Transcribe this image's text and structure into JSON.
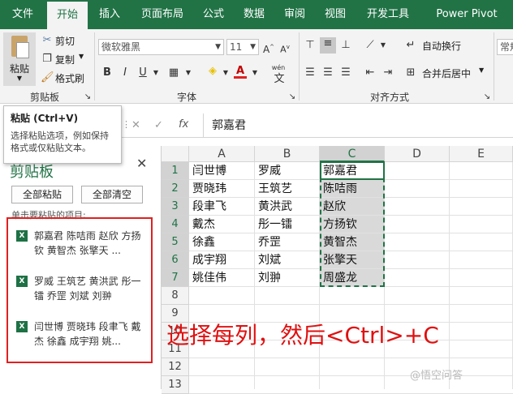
{
  "tabs": [
    "文件",
    "开始",
    "插入",
    "页面布局",
    "公式",
    "数据",
    "审阅",
    "视图",
    "开发工具",
    "Power Pivot"
  ],
  "active_tab": "开始",
  "ribbon": {
    "paste": "粘贴",
    "cut": "剪切",
    "copy": "复制",
    "format_painter": "格式刷",
    "group_clipboard": "剪贴板",
    "font_name": "微软雅黑",
    "font_size": "11",
    "bold": "B",
    "italic": "I",
    "underline": "U",
    "phonetic": "wén",
    "font_color_letter": "A",
    "group_font": "字体",
    "wrap_text": "自动换行",
    "merge_center": "合并后居中",
    "group_alignment": "对齐方式",
    "number_format": "常规"
  },
  "tooltip": {
    "title": "粘贴 (Ctrl+V)",
    "body": "选择粘贴选项，例如保持格式或仅粘贴文本。"
  },
  "formula_bar": {
    "cancel": "✕",
    "enter": "✓",
    "fx": "fx",
    "content": "郭嘉君"
  },
  "clipboard_pane": {
    "title": "剪贴板",
    "close": "✕",
    "paste_all": "全部粘贴",
    "clear_all": "全部清空",
    "hint": "单击要粘贴的项目:",
    "items": [
      "郭嘉君 陈咭雨 赵欣 方扬钦 黄智杰 张擎天 ...",
      "罗威 王筑艺 黄洪武 彤一镭 乔罡 刘斌 刘翀",
      "闫世博 贾晓玮 段聿飞 戴杰 徐鑫 成宇翔 姚..."
    ]
  },
  "grid": {
    "columns": [
      "A",
      "B",
      "C",
      "D",
      "E"
    ],
    "rows": [
      "1",
      "2",
      "3",
      "4",
      "5",
      "6",
      "7",
      "8",
      "9",
      "10",
      "11",
      "12",
      "13"
    ],
    "cells": [
      [
        "闫世博",
        "罗威",
        "郭嘉君"
      ],
      [
        "贾晓玮",
        "王筑艺",
        "陈咭雨"
      ],
      [
        "段聿飞",
        "黄洪武",
        "赵欣"
      ],
      [
        "戴杰",
        "彤一镭",
        "方扬钦"
      ],
      [
        "徐鑫",
        "乔罡",
        "黄智杰"
      ],
      [
        "成宇翔",
        "刘斌",
        "张擎天"
      ],
      [
        "姚佳伟",
        "刘翀",
        "周盛龙"
      ]
    ]
  },
  "annotation": "选择每列，然后<Ctrl>+C",
  "watermark": "@悟空问答",
  "colors": {
    "excel_green": "#217346",
    "annotation_red": "#e01010"
  }
}
